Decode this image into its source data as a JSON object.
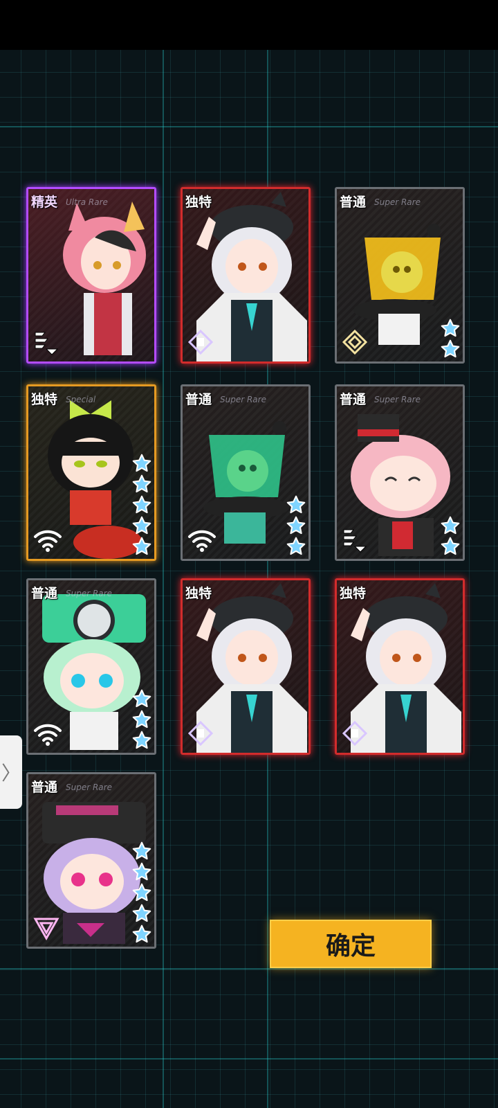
{
  "confirm_button": {
    "label": "确定"
  },
  "side_handle": {
    "glyph": "〉"
  },
  "cards": [
    {
      "tier": "精英",
      "rarity_text": "Ultra Rare",
      "tier_class": "elite",
      "stars": 0,
      "class_icon": "blade-class-icon",
      "art": "pink-fox-girl"
    },
    {
      "tier": "独特",
      "rarity_text": "",
      "tier_class": "unique",
      "stars": 0,
      "class_icon": "diamond-class-icon",
      "art": "white-haired-cap-girl"
    },
    {
      "tier": "普通",
      "rarity_text": "Super Rare",
      "tier_class": "normal",
      "stars": 2,
      "class_icon": "diamond-ring-class-icon",
      "art": "yellow-skull-jelly"
    },
    {
      "tier": "独特",
      "rarity_text": "Special",
      "tier_class": "special",
      "stars": 5,
      "class_icon": "wifi-class-icon",
      "art": "black-hair-bow-girl"
    },
    {
      "tier": "普通",
      "rarity_text": "Super Rare",
      "tier_class": "normal",
      "stars": 3,
      "class_icon": "wifi-class-icon",
      "art": "green-skull-jelly"
    },
    {
      "tier": "普通",
      "rarity_text": "Super Rare",
      "tier_class": "normal",
      "stars": 2,
      "class_icon": "blade-class-icon",
      "art": "pink-hair-hat-girl"
    },
    {
      "tier": "普通",
      "rarity_text": "Super Rare",
      "tier_class": "normal",
      "stars": 3,
      "class_icon": "wifi-class-icon",
      "art": "mint-hair-fan-girl"
    },
    {
      "tier": "独特",
      "rarity_text": "",
      "tier_class": "unique",
      "stars": 0,
      "class_icon": "diamond-class-icon",
      "art": "white-haired-cap-girl"
    },
    {
      "tier": "独特",
      "rarity_text": "",
      "tier_class": "unique",
      "stars": 0,
      "class_icon": "diamond-class-icon",
      "art": "white-haired-cap-girl"
    },
    {
      "tier": "普通",
      "rarity_text": "Super Rare",
      "tier_class": "normal",
      "stars": 5,
      "class_icon": "triangle-class-icon",
      "art": "purple-hair-visor-girl"
    }
  ],
  "colors": {
    "accent": "#f5b321",
    "elite": "#b44cff",
    "unique": "#d22c2c",
    "special": "#e59a22",
    "star": "#6fd0ff"
  }
}
